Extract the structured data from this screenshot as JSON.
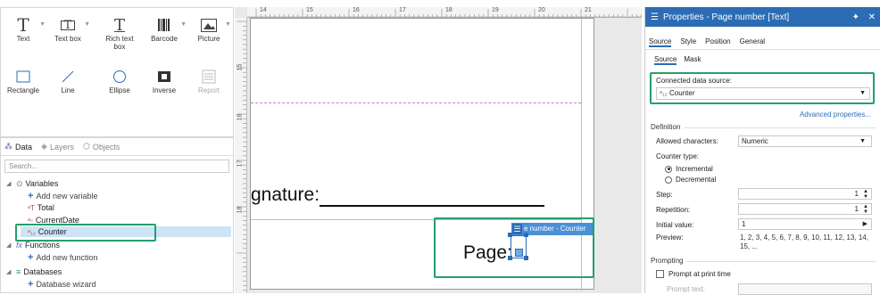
{
  "toolbox": {
    "tools_row1": [
      {
        "label": "Text",
        "icon": "text-icon",
        "glyph": "T",
        "dropdown": true
      },
      {
        "label": "Text box",
        "icon": "text-box-icon",
        "glyph": "T",
        "dropdown": true
      },
      {
        "label": "Rich text box",
        "icon": "rich-text-box-icon",
        "glyph": "T",
        "dropdown": false
      },
      {
        "label": "Barcode",
        "icon": "barcode-icon",
        "glyph": "|||",
        "dropdown": true
      },
      {
        "label": "Picture",
        "icon": "picture-icon",
        "glyph": "▲",
        "dropdown": true
      }
    ],
    "tools_row2": [
      {
        "label": "Rectangle",
        "icon": "rectangle-icon",
        "glyph": "□"
      },
      {
        "label": "Line",
        "icon": "line-icon",
        "glyph": "╱"
      },
      {
        "label": "Ellipse",
        "icon": "ellipse-icon",
        "glyph": "○"
      },
      {
        "label": "Inverse",
        "icon": "inverse-icon",
        "glyph": "▣"
      },
      {
        "label": "Report",
        "icon": "report-icon",
        "glyph": "≣"
      }
    ]
  },
  "datapanel": {
    "tabs": [
      "Data",
      "Layers",
      "Objects"
    ],
    "search_placeholder": "Search...",
    "tree": {
      "variables": "Variables",
      "add_variable": "Add new variable",
      "total": "Total",
      "current_date": "CurrentDate",
      "counter": "Counter",
      "functions": "Functions",
      "add_function": "Add new function",
      "databases": "Databases",
      "database_wizard": "Database wizard"
    }
  },
  "canvas": {
    "ruler_top": [
      "14",
      "15",
      "16",
      "17",
      "18",
      "19",
      "20",
      "21"
    ],
    "ruler_left": [
      "15",
      "16",
      "17",
      "18"
    ],
    "signature_text": "gnature:",
    "page_text": "Page:",
    "selection_label": "e number - Counter"
  },
  "props": {
    "title": "Properties - Page number [Text]",
    "tabs": [
      "Source",
      "Style",
      "Position",
      "General"
    ],
    "subtabs": [
      "Source",
      "Mask"
    ],
    "connected_label": "Connected data source:",
    "connected_value": "Counter",
    "advanced_link": "Advanced properties...",
    "definition_title": "Definition",
    "allowed_label": "Allowed characters:",
    "allowed_value": "Numeric",
    "counter_type_label": "Counter type:",
    "incremental": "Incremental",
    "decremental": "Decremental",
    "step_label": "Step:",
    "step_value": "1",
    "repetition_label": "Repetition:",
    "repetition_value": "1",
    "initial_label": "Initial value:",
    "initial_value": "1",
    "preview_label": "Preview:",
    "preview_value": "1, 2, 3, 4, 5, 6, 7, 8, 9, 10, 11, 12, 13, 14, 15, ...",
    "prompting_title": "Prompting",
    "prompt_print": "Prompt at print time",
    "prompt_text_label": "Prompt text:"
  },
  "colors": {
    "accent": "#2b6cb5",
    "highlight": "#22a06b",
    "selection": "#cde4f7"
  }
}
